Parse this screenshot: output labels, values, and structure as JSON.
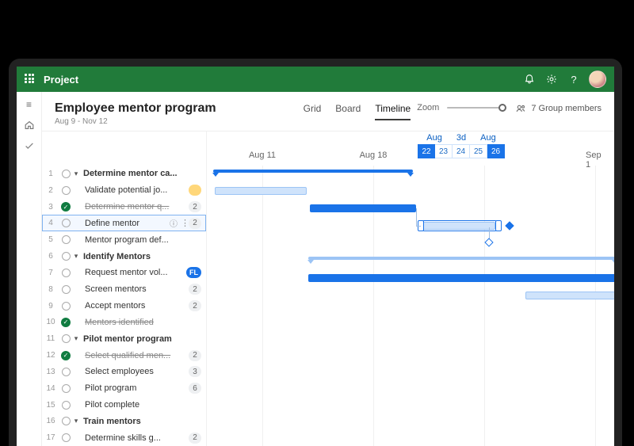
{
  "app": {
    "title": "Project"
  },
  "rail": {
    "menu": "≡",
    "home": "⌂",
    "check": "✓"
  },
  "page": {
    "title": "Employee mentor program",
    "date_range": "Aug 9 - Nov 12"
  },
  "tabs": {
    "grid": "Grid",
    "board": "Board",
    "timeline": "Timeline",
    "active": "timeline"
  },
  "zoom": {
    "label": "Zoom"
  },
  "members": {
    "label": "7 Group members"
  },
  "timeline": {
    "ticks": [
      "Aug 11",
      "Aug 18",
      "Sep 1"
    ],
    "chip_top": [
      "Aug",
      "3d",
      "Aug"
    ],
    "chip_days": [
      "22",
      "23",
      "24",
      "25",
      "26"
    ],
    "chip_selected": [
      0,
      4
    ]
  },
  "tasks": [
    {
      "n": 1,
      "kind": "summary",
      "label": "Determine mentor ca..."
    },
    {
      "n": 2,
      "kind": "item",
      "label": "Validate potential jo...",
      "badge_type": "avatar2",
      "badge": " "
    },
    {
      "n": 3,
      "kind": "done",
      "label": "Determine mentor q...",
      "strike": true,
      "badge": "2"
    },
    {
      "n": 4,
      "kind": "item",
      "label": "Define mentor",
      "selected": true,
      "info": true,
      "more": true,
      "badge": "2"
    },
    {
      "n": 5,
      "kind": "item",
      "label": "Mentor program def..."
    },
    {
      "n": 6,
      "kind": "summary",
      "label": "Identify Mentors"
    },
    {
      "n": 7,
      "kind": "item",
      "label": "Request mentor vol...",
      "badge_type": "fl",
      "badge": "FL"
    },
    {
      "n": 8,
      "kind": "item",
      "label": "Screen mentors",
      "badge": "2"
    },
    {
      "n": 9,
      "kind": "item",
      "label": "Accept mentors",
      "badge": "2"
    },
    {
      "n": 10,
      "kind": "done",
      "label": "Mentors identified",
      "strike": true
    },
    {
      "n": 11,
      "kind": "summary",
      "label": "Pilot mentor program"
    },
    {
      "n": 12,
      "kind": "done",
      "label": "Select qualified men...",
      "strike": true,
      "badge": "2"
    },
    {
      "n": 13,
      "kind": "item",
      "label": "Select employees",
      "badge": "3"
    },
    {
      "n": 14,
      "kind": "item",
      "label": "Pilot program",
      "badge": "6"
    },
    {
      "n": 15,
      "kind": "item",
      "label": "Pilot complete"
    },
    {
      "n": 16,
      "kind": "summary",
      "label": "Train mentors"
    },
    {
      "n": 17,
      "kind": "item",
      "label": "Determine skills g...",
      "badge": "2"
    }
  ]
}
